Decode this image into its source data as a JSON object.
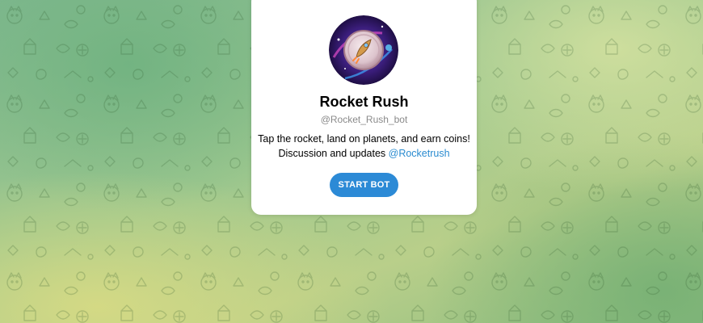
{
  "bot": {
    "name": "Rocket Rush",
    "username": "@Rocket_Rush_bot",
    "description_line1": "Tap the rocket, land on planets, and earn coins!",
    "description_line2_prefix": "Discussion and updates ",
    "description_link": "@Rocketrush",
    "avatar_icon": "rocket-coin-icon"
  },
  "actions": {
    "start_label": "START BOT"
  },
  "colors": {
    "accent": "#2c8ad6",
    "link": "#2a8bd0",
    "username": "#8a8a8a"
  }
}
